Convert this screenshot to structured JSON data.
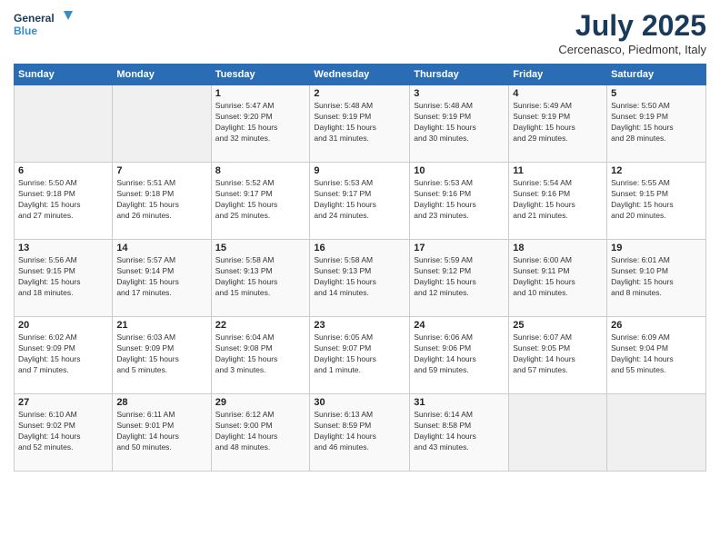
{
  "logo": {
    "line1": "General",
    "line2": "Blue"
  },
  "title": "July 2025",
  "subtitle": "Cercenasco, Piedmont, Italy",
  "header": {
    "days": [
      "Sunday",
      "Monday",
      "Tuesday",
      "Wednesday",
      "Thursday",
      "Friday",
      "Saturday"
    ]
  },
  "weeks": [
    [
      {
        "day": "",
        "info": ""
      },
      {
        "day": "",
        "info": ""
      },
      {
        "day": "1",
        "info": "Sunrise: 5:47 AM\nSunset: 9:20 PM\nDaylight: 15 hours\nand 32 minutes."
      },
      {
        "day": "2",
        "info": "Sunrise: 5:48 AM\nSunset: 9:19 PM\nDaylight: 15 hours\nand 31 minutes."
      },
      {
        "day": "3",
        "info": "Sunrise: 5:48 AM\nSunset: 9:19 PM\nDaylight: 15 hours\nand 30 minutes."
      },
      {
        "day": "4",
        "info": "Sunrise: 5:49 AM\nSunset: 9:19 PM\nDaylight: 15 hours\nand 29 minutes."
      },
      {
        "day": "5",
        "info": "Sunrise: 5:50 AM\nSunset: 9:19 PM\nDaylight: 15 hours\nand 28 minutes."
      }
    ],
    [
      {
        "day": "6",
        "info": "Sunrise: 5:50 AM\nSunset: 9:18 PM\nDaylight: 15 hours\nand 27 minutes."
      },
      {
        "day": "7",
        "info": "Sunrise: 5:51 AM\nSunset: 9:18 PM\nDaylight: 15 hours\nand 26 minutes."
      },
      {
        "day": "8",
        "info": "Sunrise: 5:52 AM\nSunset: 9:17 PM\nDaylight: 15 hours\nand 25 minutes."
      },
      {
        "day": "9",
        "info": "Sunrise: 5:53 AM\nSunset: 9:17 PM\nDaylight: 15 hours\nand 24 minutes."
      },
      {
        "day": "10",
        "info": "Sunrise: 5:53 AM\nSunset: 9:16 PM\nDaylight: 15 hours\nand 23 minutes."
      },
      {
        "day": "11",
        "info": "Sunrise: 5:54 AM\nSunset: 9:16 PM\nDaylight: 15 hours\nand 21 minutes."
      },
      {
        "day": "12",
        "info": "Sunrise: 5:55 AM\nSunset: 9:15 PM\nDaylight: 15 hours\nand 20 minutes."
      }
    ],
    [
      {
        "day": "13",
        "info": "Sunrise: 5:56 AM\nSunset: 9:15 PM\nDaylight: 15 hours\nand 18 minutes."
      },
      {
        "day": "14",
        "info": "Sunrise: 5:57 AM\nSunset: 9:14 PM\nDaylight: 15 hours\nand 17 minutes."
      },
      {
        "day": "15",
        "info": "Sunrise: 5:58 AM\nSunset: 9:13 PM\nDaylight: 15 hours\nand 15 minutes."
      },
      {
        "day": "16",
        "info": "Sunrise: 5:58 AM\nSunset: 9:13 PM\nDaylight: 15 hours\nand 14 minutes."
      },
      {
        "day": "17",
        "info": "Sunrise: 5:59 AM\nSunset: 9:12 PM\nDaylight: 15 hours\nand 12 minutes."
      },
      {
        "day": "18",
        "info": "Sunrise: 6:00 AM\nSunset: 9:11 PM\nDaylight: 15 hours\nand 10 minutes."
      },
      {
        "day": "19",
        "info": "Sunrise: 6:01 AM\nSunset: 9:10 PM\nDaylight: 15 hours\nand 8 minutes."
      }
    ],
    [
      {
        "day": "20",
        "info": "Sunrise: 6:02 AM\nSunset: 9:09 PM\nDaylight: 15 hours\nand 7 minutes."
      },
      {
        "day": "21",
        "info": "Sunrise: 6:03 AM\nSunset: 9:09 PM\nDaylight: 15 hours\nand 5 minutes."
      },
      {
        "day": "22",
        "info": "Sunrise: 6:04 AM\nSunset: 9:08 PM\nDaylight: 15 hours\nand 3 minutes."
      },
      {
        "day": "23",
        "info": "Sunrise: 6:05 AM\nSunset: 9:07 PM\nDaylight: 15 hours\nand 1 minute."
      },
      {
        "day": "24",
        "info": "Sunrise: 6:06 AM\nSunset: 9:06 PM\nDaylight: 14 hours\nand 59 minutes."
      },
      {
        "day": "25",
        "info": "Sunrise: 6:07 AM\nSunset: 9:05 PM\nDaylight: 14 hours\nand 57 minutes."
      },
      {
        "day": "26",
        "info": "Sunrise: 6:09 AM\nSunset: 9:04 PM\nDaylight: 14 hours\nand 55 minutes."
      }
    ],
    [
      {
        "day": "27",
        "info": "Sunrise: 6:10 AM\nSunset: 9:02 PM\nDaylight: 14 hours\nand 52 minutes."
      },
      {
        "day": "28",
        "info": "Sunrise: 6:11 AM\nSunset: 9:01 PM\nDaylight: 14 hours\nand 50 minutes."
      },
      {
        "day": "29",
        "info": "Sunrise: 6:12 AM\nSunset: 9:00 PM\nDaylight: 14 hours\nand 48 minutes."
      },
      {
        "day": "30",
        "info": "Sunrise: 6:13 AM\nSunset: 8:59 PM\nDaylight: 14 hours\nand 46 minutes."
      },
      {
        "day": "31",
        "info": "Sunrise: 6:14 AM\nSunset: 8:58 PM\nDaylight: 14 hours\nand 43 minutes."
      },
      {
        "day": "",
        "info": ""
      },
      {
        "day": "",
        "info": ""
      }
    ]
  ]
}
